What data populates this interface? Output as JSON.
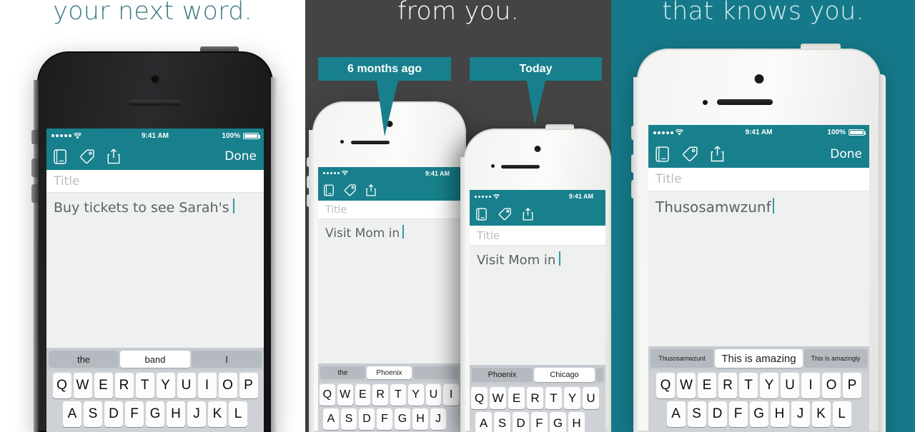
{
  "panels": [
    {
      "id": "left",
      "headline": "your next word.",
      "background_color": "#ffffff",
      "headline_color": "#3a7c84",
      "phones": [
        {
          "id": "left-phone",
          "case": "black",
          "status_bar": {
            "time": "9:41 AM",
            "battery_percent": "100%",
            "signal_dots": 5
          },
          "navbar": {
            "icons": [
              "notebook-icon",
              "tag-icon",
              "share-icon"
            ],
            "done_label": "Done"
          },
          "title_placeholder": "Title",
          "note_text": "Buy tickets to see Sarah's",
          "predictions": [
            "the",
            "band",
            "I"
          ],
          "selected_prediction_index": 1,
          "keyboard_rows": [
            [
              "Q",
              "W",
              "E",
              "R",
              "T",
              "Y",
              "U",
              "I",
              "O",
              "P"
            ],
            [
              "A",
              "S",
              "D",
              "F",
              "G",
              "H",
              "J",
              "K",
              "L"
            ]
          ]
        }
      ]
    },
    {
      "id": "middle",
      "headline": "from you.",
      "background_color": "#444444",
      "headline_color": "#ffffff",
      "callouts": [
        {
          "label": "6 months ago"
        },
        {
          "label": "Today"
        }
      ],
      "phones": [
        {
          "id": "mid-phone-back",
          "case": "white",
          "status_bar": {
            "time": "9:41 AM",
            "battery_percent": "",
            "signal_dots": 5
          },
          "navbar": {
            "icons": [
              "notebook-icon",
              "tag-icon",
              "share-icon"
            ],
            "done_label": ""
          },
          "title_placeholder": "Title",
          "note_text": "Visit Mom in",
          "predictions": [
            "the",
            "Phoenix",
            ""
          ],
          "selected_prediction_index": 1,
          "keyboard_rows": [
            [
              "Q",
              "W",
              "E",
              "R",
              "T",
              "Y",
              "U",
              "I"
            ],
            [
              "A",
              "S",
              "D",
              "F",
              "G",
              "H",
              "J"
            ]
          ]
        },
        {
          "id": "mid-phone-front",
          "case": "white",
          "status_bar": {
            "time": "9:41 AM",
            "battery_percent": "",
            "signal_dots": 5
          },
          "navbar": {
            "icons": [
              "notebook-icon",
              "tag-icon",
              "share-icon"
            ],
            "done_label": ""
          },
          "title_placeholder": "Title",
          "note_text": "Visit Mom in",
          "predictions": [
            "Phoenix",
            "Chicago",
            ""
          ],
          "selected_prediction_index": 1,
          "keyboard_rows": [
            [
              "Q",
              "W",
              "E",
              "R",
              "T",
              "Y",
              "U"
            ],
            [
              "A",
              "S",
              "D",
              "F",
              "G",
              "H"
            ]
          ]
        }
      ]
    },
    {
      "id": "right",
      "headline": "that knows you.",
      "background_color": "#15798a",
      "headline_color": "#d6eef0",
      "phones": [
        {
          "id": "right-phone",
          "case": "white",
          "status_bar": {
            "time": "9:41 AM",
            "battery_percent": "100%",
            "signal_dots": 5
          },
          "navbar": {
            "icons": [
              "notebook-icon",
              "tag-icon",
              "share-icon"
            ],
            "done_label": "Done"
          },
          "title_placeholder": "Title",
          "note_text": "Thusosamwzunf",
          "predictions": [
            "Thusosamwzunt",
            "This is amazing",
            "This is amazingly"
          ],
          "selected_prediction_index": 1,
          "keyboard_rows": [
            [
              "Q",
              "W",
              "E",
              "R",
              "T",
              "Y",
              "U",
              "I",
              "O",
              "P"
            ],
            [
              "A",
              "S",
              "D",
              "F",
              "G",
              "H",
              "J",
              "K",
              "L"
            ]
          ]
        }
      ]
    }
  ],
  "colors": {
    "teal": "#17808c",
    "teal_bg": "#15798a",
    "dark_gray": "#444444",
    "note_bg": "#eff0f0",
    "keyboard_bg": "#ced2d7"
  }
}
